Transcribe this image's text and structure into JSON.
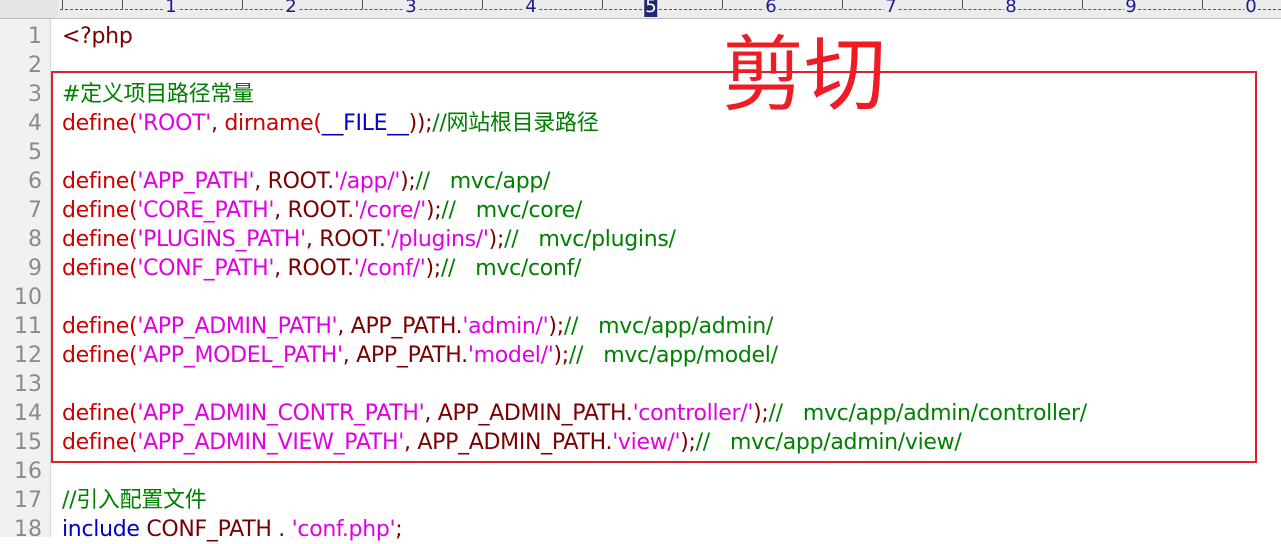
{
  "ruler": {
    "numbers": [
      "1",
      "2",
      "3",
      "4",
      "5",
      "6",
      "7",
      "8",
      "9",
      "0"
    ],
    "current_column_label": "5"
  },
  "overlay_label": "剪切",
  "lines": [
    {
      "n": "1",
      "tokens": [
        {
          "t": "<?php",
          "c": "p"
        }
      ]
    },
    {
      "n": "2",
      "tokens": []
    },
    {
      "n": "3",
      "tokens": [
        {
          "t": "#定义项目路径常量",
          "c": "c"
        }
      ]
    },
    {
      "n": "4",
      "tokens": [
        {
          "t": "define(",
          "c": "k"
        },
        {
          "t": "'ROOT'",
          "c": "s"
        },
        {
          "t": ", ",
          "c": "p"
        },
        {
          "t": "dirname(",
          "c": "k"
        },
        {
          "t": "__FILE__",
          "c": "kw"
        },
        {
          "t": "));",
          "c": "p"
        },
        {
          "t": "//网站根目录路径",
          "c": "c"
        }
      ]
    },
    {
      "n": "5",
      "tokens": []
    },
    {
      "n": "6",
      "tokens": [
        {
          "t": "define(",
          "c": "k"
        },
        {
          "t": "'APP_PATH'",
          "c": "s"
        },
        {
          "t": ", ROOT.",
          "c": "p"
        },
        {
          "t": "'/app/'",
          "c": "s"
        },
        {
          "t": ");",
          "c": "p"
        },
        {
          "t": "//   mvc/app/",
          "c": "c"
        }
      ]
    },
    {
      "n": "7",
      "tokens": [
        {
          "t": "define(",
          "c": "k"
        },
        {
          "t": "'CORE_PATH'",
          "c": "s"
        },
        {
          "t": ", ROOT.",
          "c": "p"
        },
        {
          "t": "'/core/'",
          "c": "s"
        },
        {
          "t": ");",
          "c": "p"
        },
        {
          "t": "//   mvc/core/",
          "c": "c"
        }
      ]
    },
    {
      "n": "8",
      "tokens": [
        {
          "t": "define(",
          "c": "k"
        },
        {
          "t": "'PLUGINS_PATH'",
          "c": "s"
        },
        {
          "t": ", ROOT.",
          "c": "p"
        },
        {
          "t": "'/plugins/'",
          "c": "s"
        },
        {
          "t": ");",
          "c": "p"
        },
        {
          "t": "//   mvc/plugins/",
          "c": "c"
        }
      ]
    },
    {
      "n": "9",
      "tokens": [
        {
          "t": "define(",
          "c": "k"
        },
        {
          "t": "'CONF_PATH'",
          "c": "s"
        },
        {
          "t": ", ROOT.",
          "c": "p"
        },
        {
          "t": "'/conf/'",
          "c": "s"
        },
        {
          "t": ");",
          "c": "p"
        },
        {
          "t": "//   mvc/conf/",
          "c": "c"
        }
      ]
    },
    {
      "n": "10",
      "tokens": []
    },
    {
      "n": "11",
      "tokens": [
        {
          "t": "define(",
          "c": "k"
        },
        {
          "t": "'APP_ADMIN_PATH'",
          "c": "s"
        },
        {
          "t": ", APP_PATH.",
          "c": "p"
        },
        {
          "t": "'admin/'",
          "c": "s"
        },
        {
          "t": ");",
          "c": "p"
        },
        {
          "t": "//   mvc/app/admin/",
          "c": "c"
        }
      ]
    },
    {
      "n": "12",
      "tokens": [
        {
          "t": "define(",
          "c": "k"
        },
        {
          "t": "'APP_MODEL_PATH'",
          "c": "s"
        },
        {
          "t": ", APP_PATH.",
          "c": "p"
        },
        {
          "t": "'model/'",
          "c": "s"
        },
        {
          "t": ");",
          "c": "p"
        },
        {
          "t": "//   mvc/app/model/",
          "c": "c"
        }
      ]
    },
    {
      "n": "13",
      "tokens": []
    },
    {
      "n": "14",
      "tokens": [
        {
          "t": "define(",
          "c": "k"
        },
        {
          "t": "'APP_ADMIN_CONTR_PATH'",
          "c": "s"
        },
        {
          "t": ", APP_ADMIN_PATH.",
          "c": "p"
        },
        {
          "t": "'controller/'",
          "c": "s"
        },
        {
          "t": ");",
          "c": "p"
        },
        {
          "t": "//   mvc/app/admin/controller/",
          "c": "c"
        }
      ]
    },
    {
      "n": "15",
      "tokens": [
        {
          "t": "define(",
          "c": "k"
        },
        {
          "t": "'APP_ADMIN_VIEW_PATH'",
          "c": "s"
        },
        {
          "t": ", APP_ADMIN_PATH.",
          "c": "p"
        },
        {
          "t": "'view/'",
          "c": "s"
        },
        {
          "t": ");",
          "c": "p"
        },
        {
          "t": "//   mvc/app/admin/view/",
          "c": "c"
        }
      ]
    },
    {
      "n": "16",
      "tokens": []
    },
    {
      "n": "17",
      "tokens": [
        {
          "t": "//引入配置文件",
          "c": "c"
        }
      ]
    },
    {
      "n": "18",
      "tokens": [
        {
          "t": "include ",
          "c": "kw"
        },
        {
          "t": "CONF_PATH . ",
          "c": "p"
        },
        {
          "t": "'conf.php'",
          "c": "s"
        },
        {
          "t": ";",
          "c": "p"
        }
      ]
    }
  ],
  "colors": {
    "keyword_red": "#cc0000",
    "string_magenta": "#e000e0",
    "plain_darkred": "#7a0000",
    "builtin_blue": "#0000cc",
    "comment_green": "#008000",
    "selection_border": "#e0202a",
    "overlay_text": "#ee1c24"
  }
}
